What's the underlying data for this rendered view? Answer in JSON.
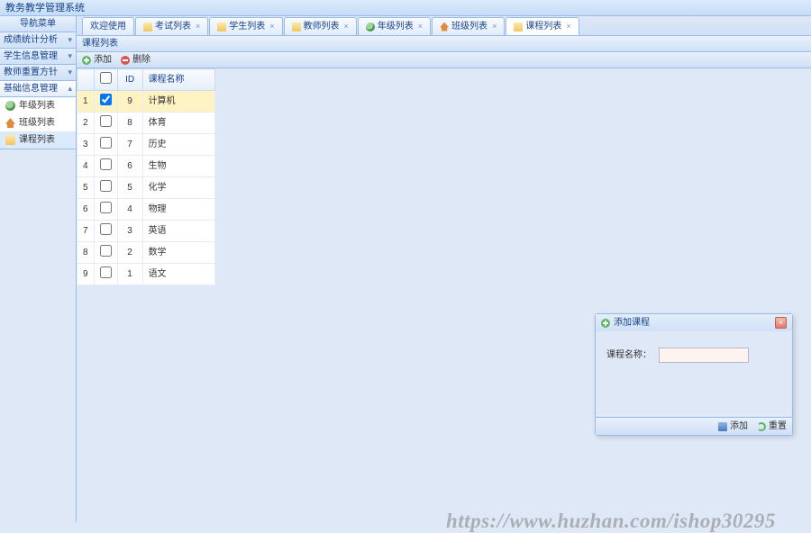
{
  "app": {
    "title": "教务教学管理系统"
  },
  "side": {
    "title": "导航菜单",
    "groups": [
      {
        "label": "成绩统计分析"
      },
      {
        "label": "学生信息管理"
      },
      {
        "label": "教师重置方针"
      },
      {
        "label": "基础信息管理"
      }
    ],
    "items": [
      {
        "label": "年级列表",
        "icon": "globe"
      },
      {
        "label": "班级列表",
        "icon": "home"
      },
      {
        "label": "课程列表",
        "icon": "folder"
      }
    ]
  },
  "tabs": [
    {
      "label": "欢迎使用",
      "closable": false
    },
    {
      "label": "考试列表",
      "closable": true
    },
    {
      "label": "学生列表",
      "closable": true
    },
    {
      "label": "教师列表",
      "closable": true
    },
    {
      "label": "年级列表",
      "closable": true
    },
    {
      "label": "班级列表",
      "closable": true
    },
    {
      "label": "课程列表",
      "closable": true
    }
  ],
  "panel": {
    "title": "课程列表"
  },
  "toolbar": {
    "add": "添加",
    "del": "删除"
  },
  "grid": {
    "cols": {
      "rownum": "",
      "check": "",
      "id": "ID",
      "name": "课程名称"
    },
    "rows": [
      {
        "n": "1",
        "id": "9",
        "name": "计算机",
        "sel": true,
        "chk": true
      },
      {
        "n": "2",
        "id": "8",
        "name": "体育",
        "sel": false,
        "chk": false
      },
      {
        "n": "3",
        "id": "7",
        "name": "历史",
        "sel": false,
        "chk": false
      },
      {
        "n": "4",
        "id": "6",
        "name": "生物",
        "sel": false,
        "chk": false
      },
      {
        "n": "5",
        "id": "5",
        "name": "化学",
        "sel": false,
        "chk": false
      },
      {
        "n": "6",
        "id": "4",
        "name": "物理",
        "sel": false,
        "chk": false
      },
      {
        "n": "7",
        "id": "3",
        "name": "英语",
        "sel": false,
        "chk": false
      },
      {
        "n": "8",
        "id": "2",
        "name": "数学",
        "sel": false,
        "chk": false
      },
      {
        "n": "9",
        "id": "1",
        "name": "语文",
        "sel": false,
        "chk": false
      }
    ]
  },
  "dialog": {
    "title": "添加课程",
    "field": "课程名称：",
    "value": "",
    "btnAdd": "添加",
    "btnReset": "重置"
  },
  "watermark": "https://www.huzhan.com/ishop30295"
}
